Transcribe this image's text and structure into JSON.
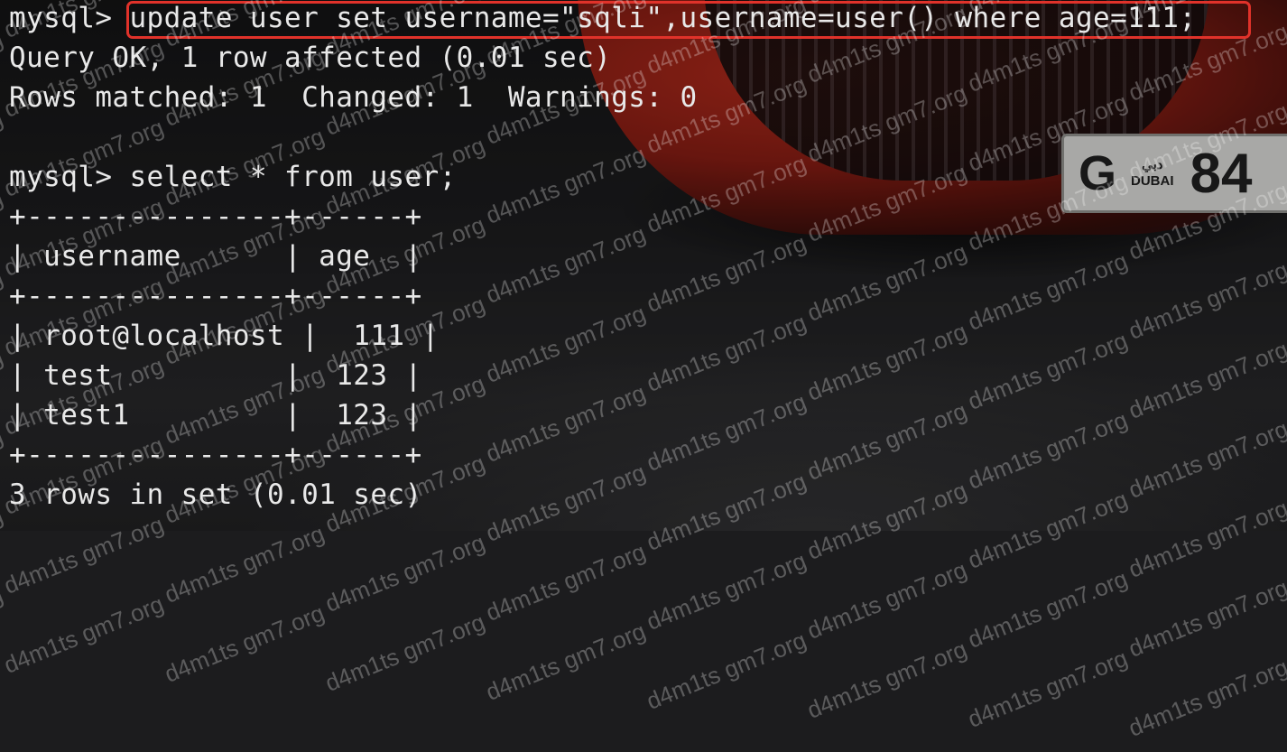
{
  "terminal": {
    "lines": [
      "mysql> update user set username=\"sqli\",username=user() where age=111;",
      "Query OK, 1 row affected (0.01 sec)",
      "Rows matched: 1  Changed: 1  Warnings: 0",
      "",
      "mysql> select * from user;",
      "+---------------+------+",
      "| username      | age  |",
      "+---------------+------+",
      "| root@localhost |  111 |",
      "| test          |  123 |",
      "| test1         |  123 |",
      "+---------------+------+",
      "3 rows in set (0.01 sec)"
    ]
  },
  "background": {
    "plate_letter": "G",
    "plate_city_arabic": "دبي",
    "plate_city": "DUBAI",
    "plate_number": "84"
  },
  "watermark": {
    "text": "d4m1ts gm7.org"
  },
  "colors": {
    "highlight_border": "#e0322a",
    "terminal_text": "#e8e8e8"
  }
}
